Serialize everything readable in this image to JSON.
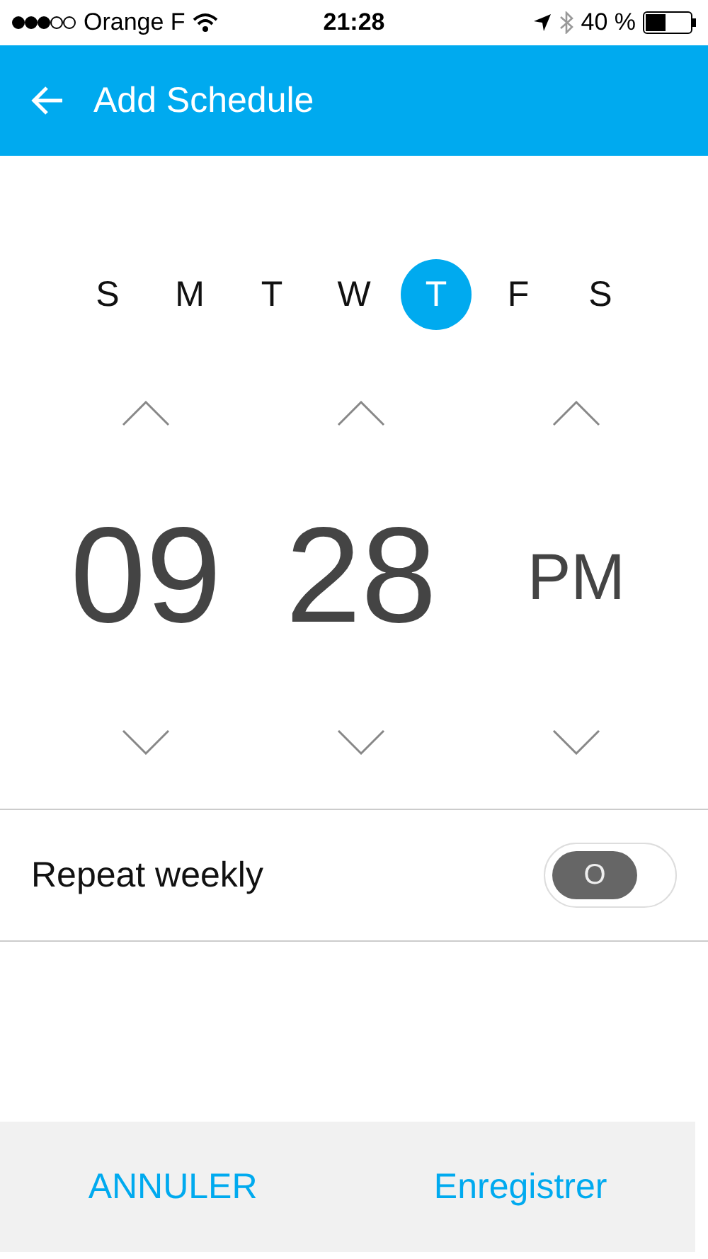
{
  "status_bar": {
    "carrier": "Orange F",
    "time": "21:28",
    "battery": "40 %"
  },
  "header": {
    "title": "Add Schedule"
  },
  "days": [
    {
      "label": "S",
      "selected": false
    },
    {
      "label": "M",
      "selected": false
    },
    {
      "label": "T",
      "selected": false
    },
    {
      "label": "W",
      "selected": false
    },
    {
      "label": "T",
      "selected": true
    },
    {
      "label": "F",
      "selected": false
    },
    {
      "label": "S",
      "selected": false
    }
  ],
  "time": {
    "hour": "09",
    "minute": "28",
    "period": "PM"
  },
  "repeat": {
    "label": "Repeat weekly",
    "toggle_label": "O",
    "on": false
  },
  "buttons": [
    {
      "label": "ANNULER"
    },
    {
      "label": "Enregistrer"
    }
  ]
}
